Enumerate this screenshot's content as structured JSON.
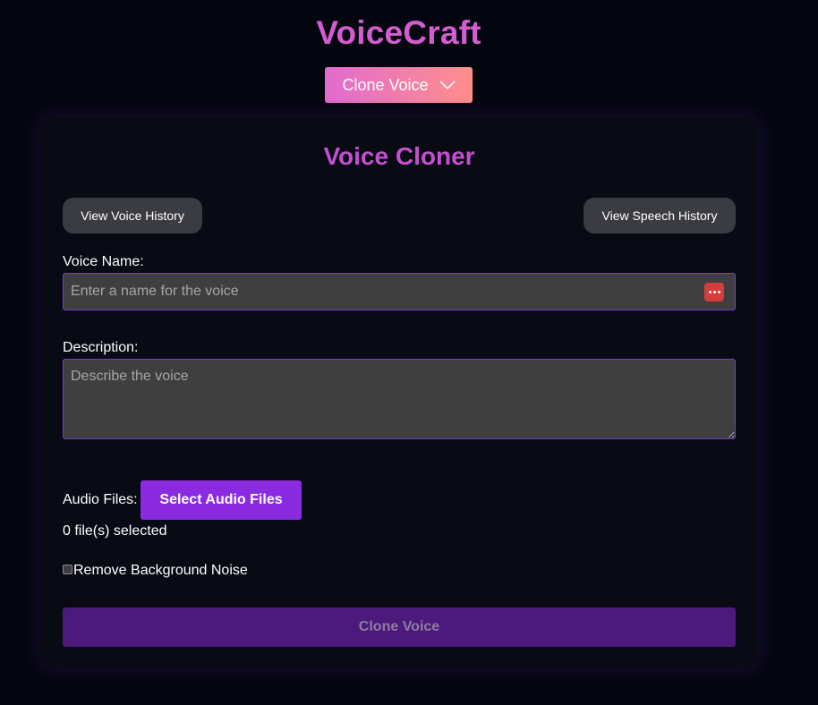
{
  "app": {
    "title": "VoiceCraft",
    "mode_selector": {
      "selected": "Clone Voice",
      "icon": "chevron-down-icon"
    }
  },
  "cloner": {
    "title": "Voice Cloner",
    "view_voice_history": "View Voice History",
    "view_speech_history": "View Speech History",
    "voice_name": {
      "label": "Voice Name:",
      "value": "",
      "placeholder": "Enter a name for the voice",
      "icon": "password-manager-icon"
    },
    "description": {
      "label": "Description:",
      "value": "",
      "placeholder": "Describe the voice"
    },
    "audio_files": {
      "label": "Audio Files:",
      "button": "Select Audio Files",
      "status": "0 file(s) selected"
    },
    "remove_noise": {
      "label": "Remove Background Noise",
      "checked": false
    },
    "submit": {
      "label": "Clone Voice",
      "disabled": true
    }
  },
  "colors": {
    "background": "#04060f",
    "card": "#080a14",
    "title_accent": "#d55cd0",
    "card_title": "#c44fd0",
    "primary_button": "#8a2be2",
    "disabled_button": "#4b1a7c",
    "dropdown_gradient_start": "#e26bcf",
    "dropdown_gradient_end": "#ff8f8a",
    "input_border": "#7c3ad0"
  }
}
